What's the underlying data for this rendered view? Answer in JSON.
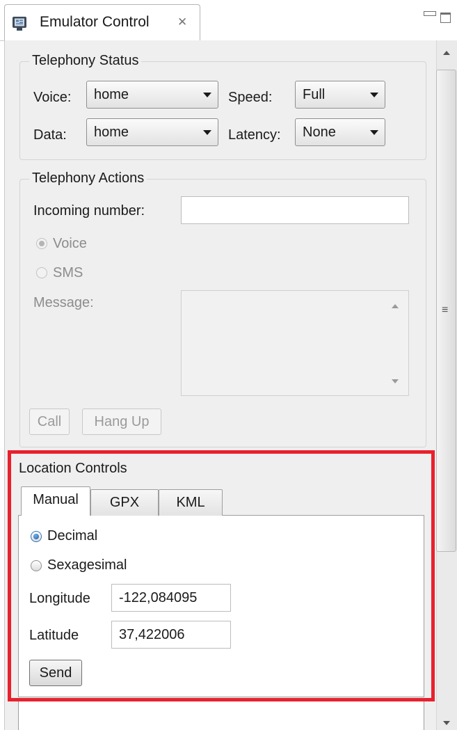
{
  "view": {
    "title": "Emulator Control",
    "icon": "emulator-icon",
    "close_glyph": "✕",
    "minimize_icon": "minimize-icon",
    "maximize_icon": "maximize-icon"
  },
  "telephony_status": {
    "title": "Telephony Status",
    "voice_label": "Voice:",
    "voice_value": "home",
    "speed_label": "Speed:",
    "speed_value": "Full",
    "data_label": "Data:",
    "data_value": "home",
    "latency_label": "Latency:",
    "latency_value": "None"
  },
  "telephony_actions": {
    "title": "Telephony Actions",
    "incoming_label": "Incoming number:",
    "incoming_value": "",
    "voice_radio": "Voice",
    "sms_radio": "SMS",
    "message_label": "Message:",
    "call_button": "Call",
    "hangup_button": "Hang Up"
  },
  "location_controls": {
    "title": "Location Controls",
    "tabs": [
      "Manual",
      "GPX",
      "KML"
    ],
    "active_tab": "Manual",
    "decimal_radio": "Decimal",
    "sexagesimal_radio": "Sexagesimal",
    "selected_format": "Decimal",
    "longitude_label": "Longitude",
    "longitude_value": "-122,084095",
    "latitude_label": "Latitude",
    "latitude_value": "37,422006",
    "send_button": "Send"
  },
  "scrollbar": {
    "grip_glyph": "≡"
  },
  "colors": {
    "highlight": "#e8212d",
    "panel_bg": "#efefef",
    "radio_selected": "#1c5aa3"
  }
}
